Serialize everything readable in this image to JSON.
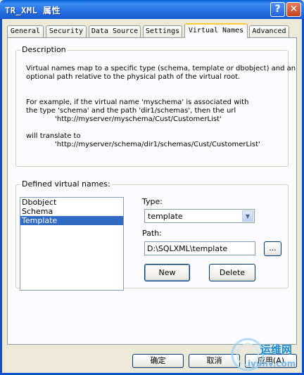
{
  "window": {
    "title": "TR_XML 属性"
  },
  "titlebar_buttons": {
    "help": "?",
    "close": "✕"
  },
  "tabs": [
    {
      "label": "General"
    },
    {
      "label": "Security"
    },
    {
      "label": "Data Source"
    },
    {
      "label": "Settings"
    },
    {
      "label": "Virtual Names",
      "active": true
    },
    {
      "label": "Advanced"
    }
  ],
  "description": {
    "label": "Description",
    "lines": [
      "Virtual names map to a specific type (schema, template or dbobject) and an",
      "optional path relative to the physical path of the virtual root.",
      "For example, if the virtual name 'myschema' is associated with",
      "the type 'schema' and the path 'dir1/schemas', then the url",
      "'http://myserver/myschema/Cust/CustomerList'",
      "will translate to",
      "'http://myserver/schema/dir1/schemas/Cust/CustomerList'"
    ]
  },
  "defined": {
    "label": "Defined virtual names:",
    "items": [
      "Dbobject",
      "Schema",
      "Template"
    ],
    "selected": "Template",
    "type_label": "Type:",
    "type_value": "template",
    "path_label": "Path:",
    "path_value": "D:\\SQLXML\\template",
    "browse_label": "...",
    "new_label": "New",
    "delete_label": "Delete"
  },
  "footer": {
    "ok": "确定",
    "cancel": "取消",
    "apply": "应用(A)"
  },
  "watermark": {
    "text": "运维网",
    "url": "iyunv.com"
  },
  "colors": {
    "titlebar": "#0a5fd6",
    "selection": "#316ac5",
    "tab_highlight": "#ffc83c",
    "watermark": "#1a8fd8"
  }
}
